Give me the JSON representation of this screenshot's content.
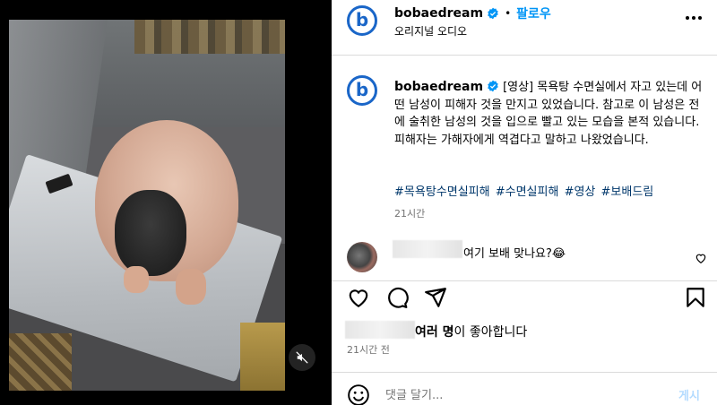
{
  "media": {
    "mute_icon": "speaker-muted-icon"
  },
  "header": {
    "avatar_letter": "b",
    "username": "bobaedream",
    "dot": "•",
    "follow_label": "팔로우",
    "audio_label": "오리지널 오디오",
    "more_icon": "more-horizontal-icon"
  },
  "caption": {
    "avatar_letter": "b",
    "username": "bobaedream",
    "text": "[영상] 목욕탕 수면실에서 자고 있는데 어떤 남성이 피해자 것을 만지고 있었습니다. 참고로 이 남성은 전에 술취한 남성의 것을 입으로 빨고 있는 모습을 본적 있습니다. 피해자는 가해자에게 역겹다고 말하고 나왔었습니다.",
    "hashtags": [
      "#목욕탕수면실피해",
      "#수면실피해",
      "#영상",
      "#보배드림"
    ],
    "time": "21시간"
  },
  "comment": {
    "text": "여기 보배 맞나요?😂"
  },
  "actions": {
    "like_icon": "heart-icon",
    "comment_icon": "comment-icon",
    "share_icon": "send-icon",
    "save_icon": "bookmark-icon"
  },
  "likes": {
    "bold": "여러 명",
    "rest": "이 좋아합니다"
  },
  "post_time": "21시간 전",
  "comment_box": {
    "placeholder": "댓글 달기...",
    "post_label": "게시"
  },
  "colors": {
    "accent": "#0095f6",
    "brand": "#1a66c8",
    "hashtag": "#00376b",
    "muted": "#737373"
  }
}
